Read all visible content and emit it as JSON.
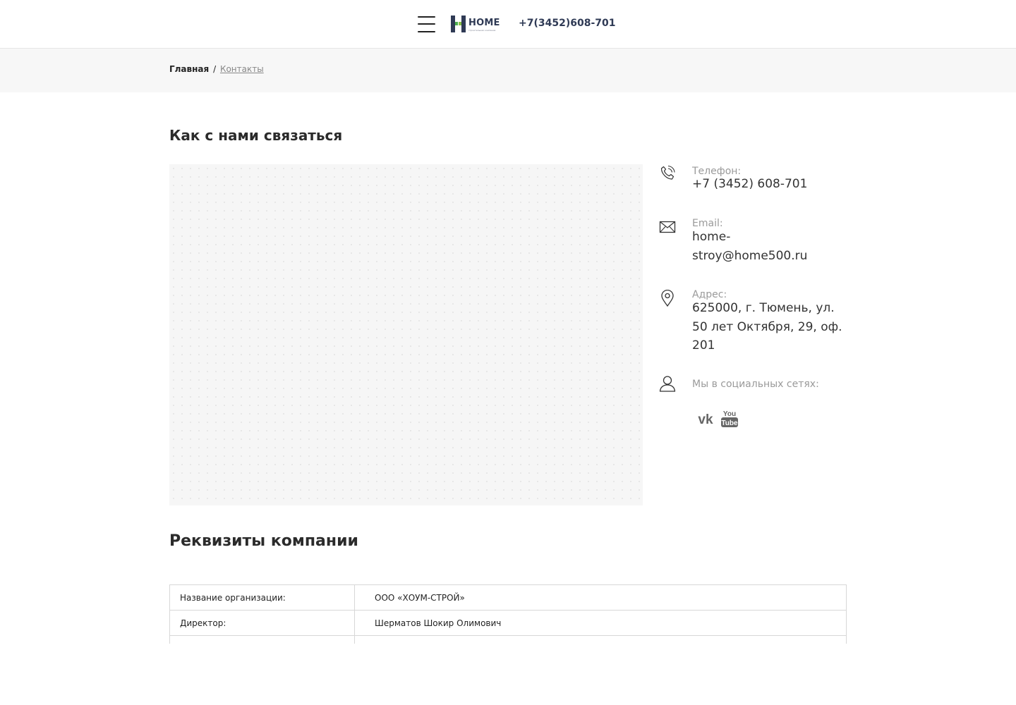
{
  "header": {
    "logo_text": "HOME",
    "logo_sub": "строительная компания",
    "phone": "+7(3452)608-701",
    "colors": {
      "logo_dark": "#2f3a55",
      "logo_green": "#4caf50"
    }
  },
  "breadcrumb": {
    "home": "Главная",
    "separator": "/",
    "current": "Контакты"
  },
  "contact": {
    "title": "Как с нами связаться",
    "phone": {
      "icon": "phone-icon",
      "label": "Телефон:",
      "value": "+7 (3452) 608-701"
    },
    "email": {
      "icon": "envelope-icon",
      "label": "Email:",
      "value": "home-\nstroy@home500.ru"
    },
    "address": {
      "icon": "location-pin-icon",
      "label": "Адрес:",
      "value": "625000, г. Тюмень, ул. 50 лет Октября, 29, оф. 201"
    },
    "social": {
      "icon": "user-icon",
      "label": "Мы в социальных сетях:",
      "links": [
        {
          "name": "vk-icon",
          "text": "vk"
        },
        {
          "name": "youtube-icon",
          "text_top": "You",
          "text_bottom": "Tube"
        }
      ]
    }
  },
  "requisites": {
    "title": "Реквизиты компании",
    "rows": [
      {
        "key": "Название организации:",
        "value": "ООО «ХОУМ-СТРОЙ»"
      },
      {
        "key": "Директор:",
        "value": "Шерматов Шокир Олимович"
      },
      {
        "key": "",
        "value": ""
      }
    ]
  }
}
